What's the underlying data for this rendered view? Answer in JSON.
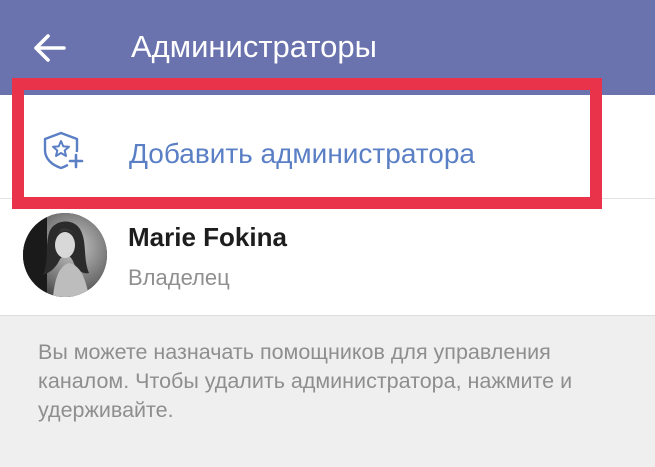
{
  "header": {
    "title": "Администраторы",
    "back_icon": "arrow-left-icon",
    "background_color": "#6a73ad"
  },
  "add_admin": {
    "label": "Добавить администратора",
    "icon": "shield-star-plus-icon",
    "accent_color": "#5a7fc4"
  },
  "highlight": {
    "color": "#e8334a"
  },
  "admins": [
    {
      "name": "Marie Fokina",
      "role": "Владелец",
      "avatar": "avatar-photo"
    }
  ],
  "hint": {
    "text": "Вы можете назначать помощников для управления каналом. Чтобы удалить администратора, нажмите и удерживайте."
  }
}
